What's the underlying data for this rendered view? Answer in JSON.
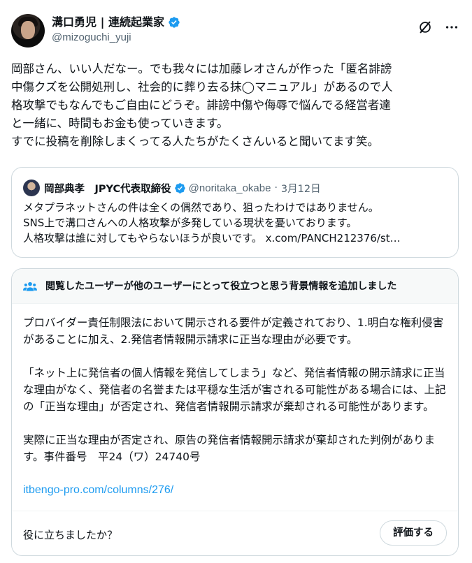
{
  "author": {
    "display_name": "溝口勇児 | 連続起業家",
    "handle": "@mizoguchi_yuji"
  },
  "tweet": {
    "text": "岡部さん、いい人だなー。でも我々には加藤レオさんが作った「匿名誹謗\n中傷クズを公開処刑し、社会的に葬り去る抹◯マニュアル」があるので人\n格攻撃でもなんでもご自由にどうぞ。誹謗中傷や侮辱で悩んでる経営者達\nと一緒に、時間もお金も使っていきます。\nすでに投稿を削除しまくってる人たちがたくさんいると聞いてます笑。"
  },
  "quote": {
    "name": "岡部典孝　JPYC代表取締役",
    "handle": "@noritaka_okabe",
    "separator": "·",
    "date": "3月12日",
    "lines": [
      "メタプラネットさんの件は全くの偶然であり、狙ったわけではありません。",
      "SNS上で溝口さんへの人格攻撃が多発している現状を憂いております。",
      "人格攻撃は誰に対してもやらないほうが良いです。 x.com/PANCH212376/st…"
    ]
  },
  "community_note": {
    "title": "閲覧したユーザーが他のユーザーにとって役立つと思う背景情報を追加しました",
    "paragraphs": [
      "プロバイダー責任制限法において開示される要件が定義されており、1.明白な権利侵害があることに加え、2.発信者情報開示請求に正当な理由が必要です。",
      "「ネット上に発信者の個人情報を発信してしまう」など、発信者情報の開示請求に正当な理由がなく、発信者の名誉または平穏な生活が害される可能性がある場合には、上記の「正当な理由」が否定され、発信者情報開示請求が棄却される可能性があります。",
      "実際に正当な理由が否定され、原告の発信者情報開示請求が棄却された判例があります。事件番号　平24（ワ）24740号"
    ],
    "link": "itbengo-pro.com/columns/276/",
    "helpful_question": "役に立ちましたか？",
    "rate_label": "評価する"
  },
  "colors": {
    "verified": "#1d9bf0",
    "link": "#1d9bf0",
    "secondary_text": "#536471",
    "border": "#cfd9de"
  },
  "icons": [
    "verified-badge-icon",
    "grok-icon",
    "more-icon",
    "people-icon"
  ]
}
